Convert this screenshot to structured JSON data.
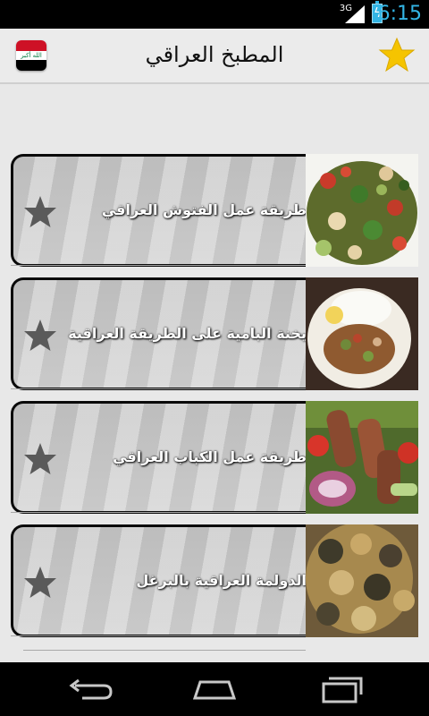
{
  "status_bar": {
    "network": "3G",
    "time": "6:15"
  },
  "action_bar": {
    "title": "المطبخ العراقي",
    "flag_text": "الله أكبر"
  },
  "recipes": [
    {
      "title": "طريقة عمل الفتوش العراقي"
    },
    {
      "title": "يخنة البامية على الطريقة العراقية"
    },
    {
      "title": "طريقة عمل الكباب العراقي"
    },
    {
      "title": "الدولمة العراقية بالبرغل"
    }
  ],
  "colors": {
    "accent": "#33b5e5",
    "favorite_star": "#f5c400",
    "card_star": "#5a5a5a"
  },
  "icons": {
    "back": "back-icon",
    "home": "home-icon",
    "recents": "recents-icon"
  }
}
